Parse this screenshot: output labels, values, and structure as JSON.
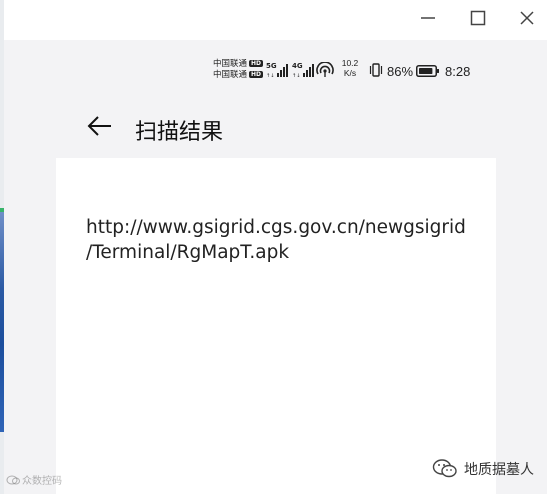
{
  "status_bar": {
    "carrier_1": "中国联通",
    "carrier_2": "中国联通",
    "hd_badge": "HD",
    "net_1": "5G",
    "net_2": "4G",
    "speed_value": "10.2",
    "speed_unit": "K/s",
    "battery_percent": "86%",
    "time": "8:28"
  },
  "header": {
    "title": "扫描结果"
  },
  "scan_result": {
    "line_1": "http://www.gsigrid.cgs.gov.cn/newgsigrid",
    "line_2": "/Terminal/RgMapT.apk"
  },
  "watermarks": {
    "left": "众数控码",
    "right": "地质据墓人"
  }
}
